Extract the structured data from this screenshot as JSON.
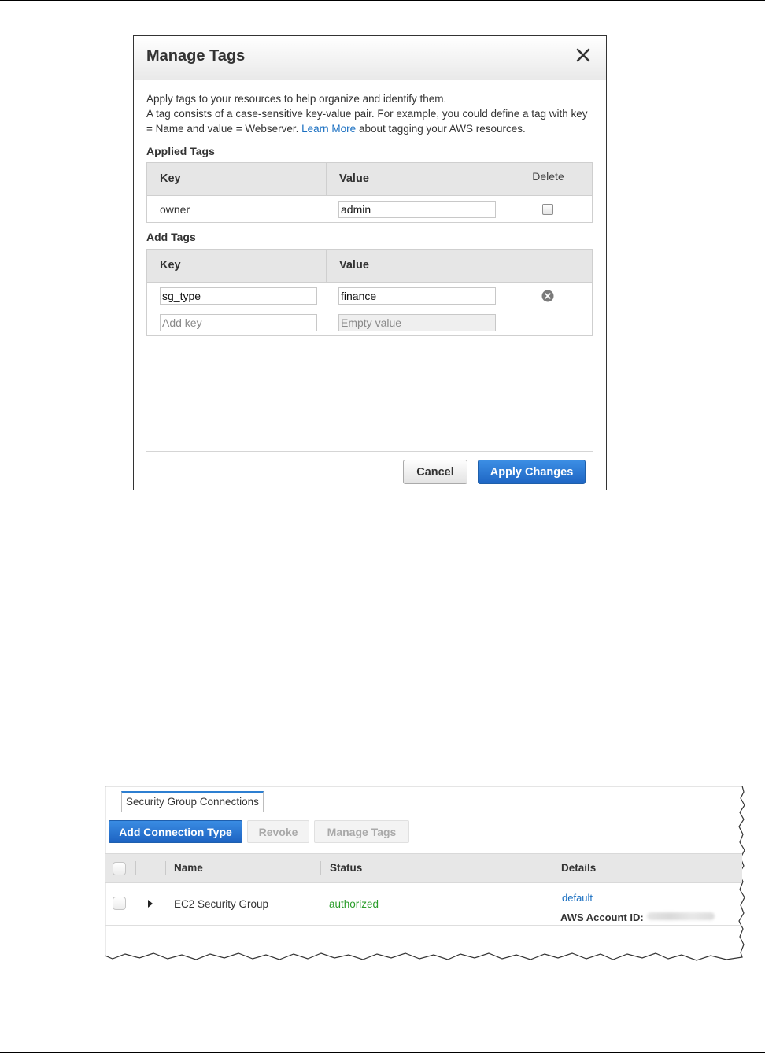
{
  "dialog": {
    "title": "Manage Tags",
    "intro_line1": "Apply tags to your resources to help organize and identify them.",
    "intro_line2": "A tag consists of a case-sensitive key-value pair. For example, you could define a tag with key",
    "intro_line3_before": "= Name and value = Webserver.",
    "learn_more": "Learn More",
    "intro_line3_after": "about tagging your AWS resources.",
    "applied_tags_label": "Applied Tags",
    "applied_tags_headers": {
      "key": "Key",
      "value": "Value",
      "delete": "Delete"
    },
    "applied_tags": [
      {
        "key": "owner",
        "value": "admin",
        "delete_checked": false
      }
    ],
    "add_tags_label": "Add Tags",
    "add_tags_headers": {
      "key": "Key",
      "value": "Value"
    },
    "add_tags": [
      {
        "key": "sg_type",
        "value": "finance"
      }
    ],
    "new_key_placeholder": "Add key",
    "new_value_placeholder": "Empty value",
    "cancel_label": "Cancel",
    "apply_label": "Apply Changes"
  },
  "panel": {
    "tab_label": "Security Group Connections",
    "buttons": {
      "add": "Add Connection Type",
      "revoke": "Revoke",
      "manage_tags": "Manage Tags"
    },
    "columns": {
      "name": "Name",
      "status": "Status",
      "details": "Details"
    },
    "rows": [
      {
        "name": "EC2 Security Group",
        "status": "authorized",
        "details_link": "default",
        "account_label": "AWS Account ID:"
      }
    ]
  },
  "colors": {
    "primary_button": "#1f66c4",
    "link": "#1a6fc1",
    "status_ok": "#2a9d2a"
  }
}
